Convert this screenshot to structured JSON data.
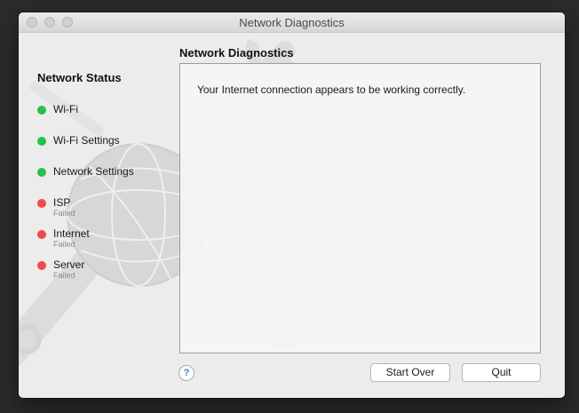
{
  "window": {
    "title": "Network Diagnostics"
  },
  "sidebar": {
    "heading": "Network Status",
    "items": [
      {
        "label": "Wi-Fi",
        "status": "ok",
        "sub": ""
      },
      {
        "label": "Wi-Fi Settings",
        "status": "ok",
        "sub": ""
      },
      {
        "label": "Network Settings",
        "status": "ok",
        "sub": ""
      },
      {
        "label": "ISP",
        "status": "failed",
        "sub": "Failed"
      },
      {
        "label": "Internet",
        "status": "failed",
        "sub": "Failed"
      },
      {
        "label": "Server",
        "status": "failed",
        "sub": "Failed"
      }
    ]
  },
  "main": {
    "heading": "Network Diagnostics",
    "message": "Your Internet connection appears to be working correctly."
  },
  "footer": {
    "help_icon": "?",
    "start_over_label": "Start Over",
    "quit_label": "Quit"
  },
  "colors": {
    "ok": "#27c04a",
    "failed": "#ee4b4b"
  },
  "icons": [
    "close-icon",
    "minimize-icon",
    "zoom-icon",
    "globe-wrench-icon",
    "help-icon"
  ]
}
